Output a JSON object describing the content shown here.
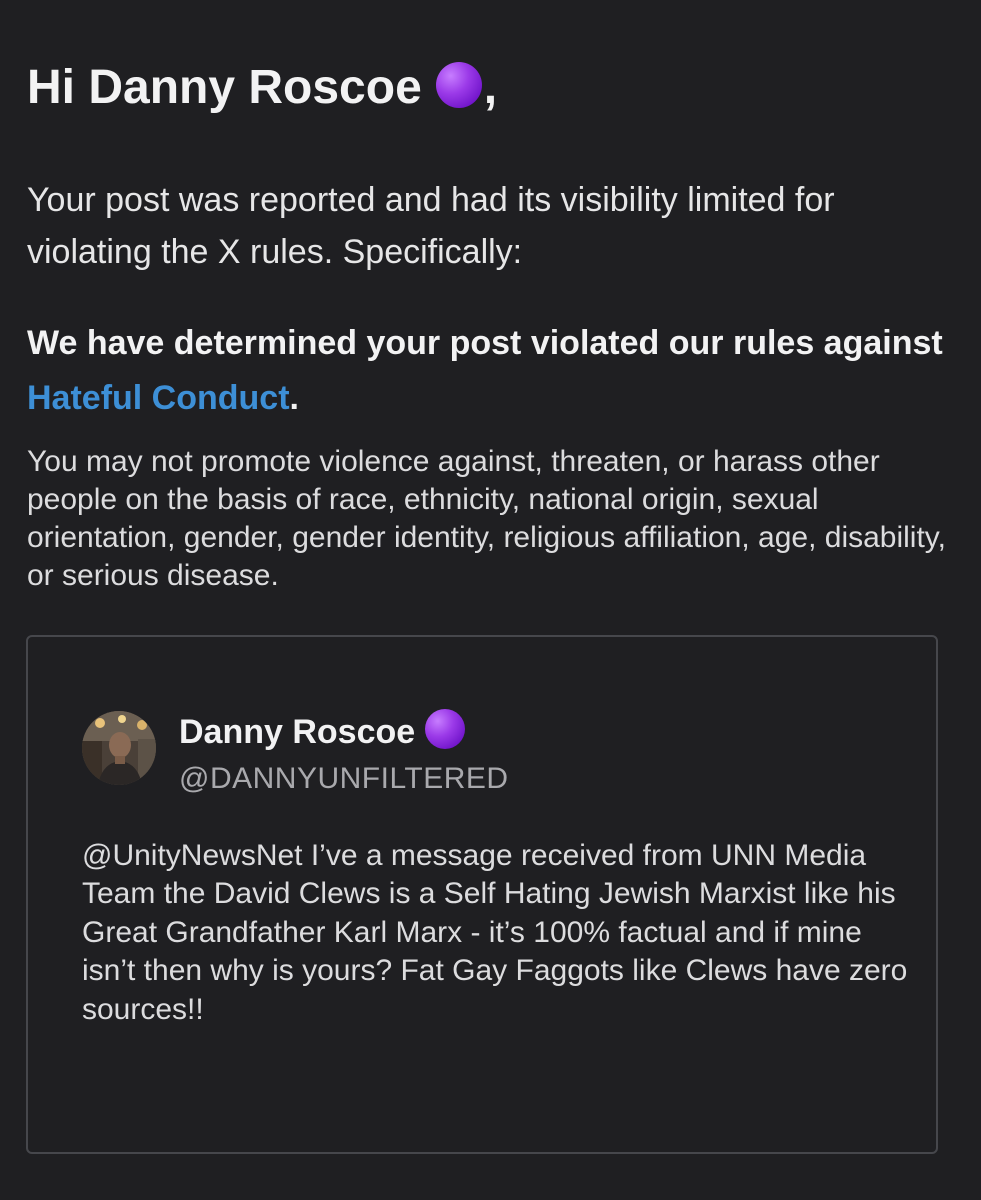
{
  "notice": {
    "greeting_prefix": "Hi Danny Roscoe",
    "greeting_suffix": ",",
    "intro": "Your post was reported and had its visibility limited for violating the X rules. Specifically:",
    "determined_prefix": "We have determined your post violated our rules against ",
    "policy_link": "Hateful Conduct",
    "determined_suffix": ".",
    "policy_description": "You may not promote violence against, threaten, or harass other people on the basis of race, ethnicity, national origin, sexual orientation, gender, gender identity, religious affiliation, age, disability, or serious disease."
  },
  "post": {
    "author_name": "Danny Roscoe",
    "handle": "@DANNYUNFILTERED",
    "text": "@UnityNewsNet I’ve a message received from UNN Media Team the David Clews is a Self Hating Jewish Marxist like his Great Grandfather Karl Marx - it’s 100% factual and if mine isn’t then why is yours? Fat Gay Faggots like Clews have zero sources!!"
  },
  "colors": {
    "background": "#1f1f22",
    "link": "#3d8fd6",
    "purple_emoji": "#8a2be2",
    "card_border": "#46474c"
  },
  "icons": {
    "name_emoji": "purple-circle-icon"
  }
}
